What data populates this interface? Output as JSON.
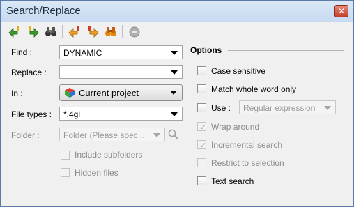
{
  "window": {
    "title": "Search/Replace"
  },
  "toolbar": {
    "icons": [
      "find-previous-icon",
      "find-next-icon",
      "find-all-icon",
      "replace-previous-icon",
      "replace-next-icon",
      "replace-all-icon",
      "stop-icon"
    ]
  },
  "find": {
    "label": "Find :",
    "value": "DYNAMIC"
  },
  "replace": {
    "label": "Replace :",
    "value": ""
  },
  "in": {
    "label": "In :",
    "value": "Current project"
  },
  "file_types": {
    "label": "File types :",
    "value": "*.4gl"
  },
  "folder": {
    "label": "Folder :",
    "placeholder": "Folder (Please spec..."
  },
  "include_subfolders": {
    "label": "Include subfolders",
    "checked": false,
    "enabled": false
  },
  "hidden_files": {
    "label": "Hidden files",
    "checked": false,
    "enabled": false
  },
  "options": {
    "title": "Options",
    "case_sensitive": {
      "label": "Case sensitive",
      "checked": false
    },
    "match_whole_word": {
      "label": "Match whole word only",
      "checked": false
    },
    "use": {
      "label": "Use :",
      "checked": false,
      "value": "Regular expression"
    },
    "wrap_around": {
      "label": "Wrap around",
      "checked": true,
      "enabled": false
    },
    "incremental_search": {
      "label": "Incremental search",
      "checked": true,
      "enabled": false
    },
    "restrict_to_selection": {
      "label": "Restrict to selection",
      "checked": false,
      "enabled": false
    },
    "text_search": {
      "label": "Text search",
      "checked": false
    }
  }
}
